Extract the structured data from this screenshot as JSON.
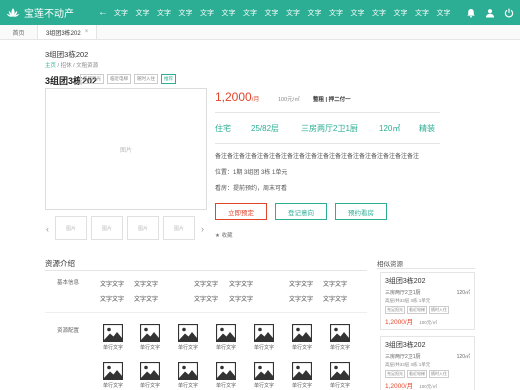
{
  "header": {
    "app_name": "宝莲不动产",
    "nav": [
      "文字",
      "文字",
      "文字",
      "文字",
      "文字",
      "文字",
      "文字",
      "文字",
      "文字",
      "文字",
      "文字",
      "文字",
      "文字",
      "文字",
      "文字",
      "文字"
    ],
    "brand_color": "#2bae94"
  },
  "tabs": {
    "home": "首页",
    "active": "3组团3栋202",
    "close": "×"
  },
  "listing": {
    "title_small": "3组团3栋202",
    "breadcrumb_home": "主页",
    "breadcrumb_rest": " / 招休 / 文租资源",
    "title": "3组团3栋202",
    "tags": [
      "充足阳光",
      "临近电梯",
      "随时入住",
      "推荐"
    ],
    "image_placeholder": "图片",
    "thumbs": [
      "图片",
      "图片",
      "图片",
      "图片"
    ],
    "price": "1,2000",
    "price_unit": "/月",
    "unit_price": "100元/㎡",
    "rent_type": "整租 | 押二付一",
    "stats": [
      "住宅",
      "25/82层",
      "三房两厅2卫1厨",
      "120㎡",
      "精装"
    ],
    "description": "备注备注备注备注备注备注备注备注备注备注备注备注备注备注备注备注备注",
    "position": "位置：1期 3组团 3栋 1单元",
    "viewing": "看房：提前预约，周末可看",
    "buttons": {
      "reserve": "立即预定",
      "intent": "登记意向",
      "viewing": "预约看房"
    },
    "favorite": "★ 收藏"
  },
  "resource_intro": {
    "title": "资源介绍",
    "basic_label": "基本信息",
    "basic_rows": [
      [
        "文字文字",
        "文字文字",
        "文字文字",
        "文字文字",
        "文字文字",
        "文字文字"
      ],
      [
        "文字文字",
        "文字文字",
        "文字文字",
        "文字文字",
        "文字文字",
        "文字文字"
      ]
    ],
    "facility_label": "资源配置",
    "facility_item": "单行文字"
  },
  "similar": {
    "title": "相似资源",
    "cards": [
      {
        "title": "3组团3栋202",
        "layout": "三房两厅2卫1厨",
        "area": "120㎡",
        "floor": "高层/共33层 3栋 1单元",
        "tags": [
          "充足阳光",
          "临近电梯",
          "随时入住"
        ],
        "price": "1,2000/月",
        "unit_price": "100元/㎡"
      },
      {
        "title": "3组团3栋202",
        "layout": "三房两厅2卫1厨",
        "area": "120㎡",
        "floor": "高层/共33层 3栋 1单元",
        "tags": [
          "充足阳光",
          "临近电梯",
          "随时入住"
        ],
        "price": "1,2000/月",
        "unit_price": "100元/㎡"
      }
    ]
  },
  "colors": {
    "accent": "#2bae94",
    "price": "#e0452c"
  }
}
